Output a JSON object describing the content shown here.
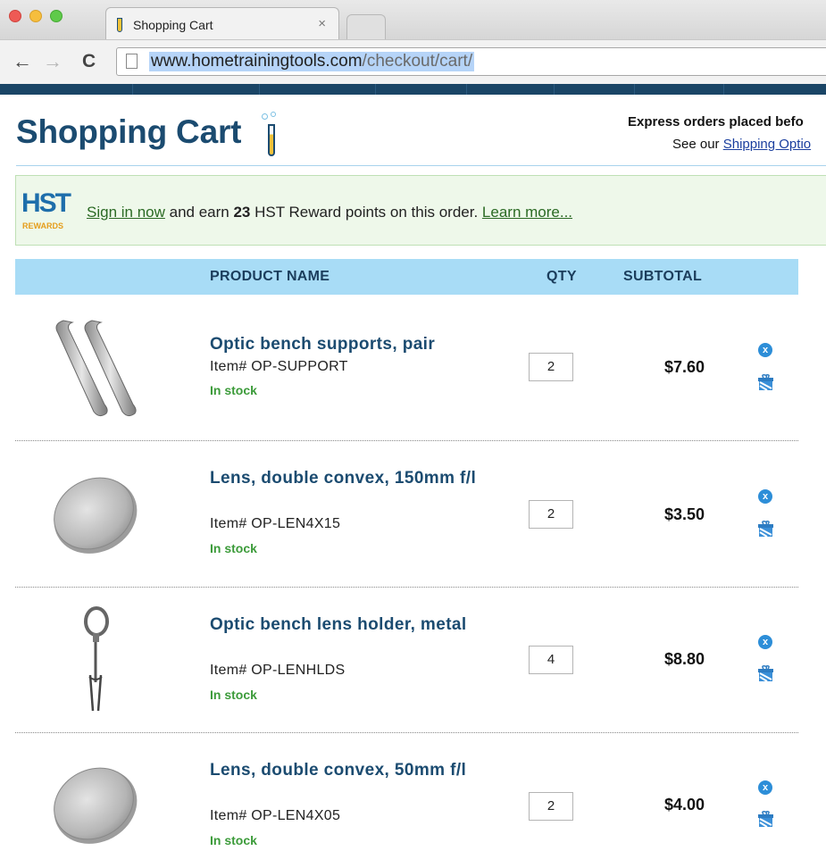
{
  "browser": {
    "tab_title": "Shopping Cart",
    "tab_close": "×",
    "nav_back": "←",
    "nav_forward": "→",
    "nav_reload": "C",
    "url_domain": "www.hometrainingtools.com",
    "url_path": "/checkout/cart/"
  },
  "page": {
    "title": "Shopping Cart",
    "express_text": "Express orders placed befo",
    "shipping_prefix": "See our ",
    "shipping_link": "Shipping Optio"
  },
  "rewards": {
    "logo_text": "HST",
    "logo_sub": "REWARDS",
    "signin_link": "Sign in now",
    "text_before_points": " and earn ",
    "points": "23",
    "text_after_points": " HST Reward points on this order. ",
    "learn_more_link": "Learn more..."
  },
  "cart_header": {
    "product_name": "PRODUCT NAME",
    "qty": "QTY",
    "subtotal": "SUBTOTAL"
  },
  "items": [
    {
      "name": "Optic bench supports, pair",
      "item": "Item# OP-SUPPORT",
      "stock": "In stock",
      "qty": "2",
      "subtotal": "$7.60",
      "thumb": "bench-supports-icon"
    },
    {
      "name": "Lens, double convex, 150mm f/l",
      "item": "Item# OP-LEN4X15",
      "stock": "In stock",
      "qty": "2",
      "subtotal": "$3.50",
      "thumb": "lens-icon"
    },
    {
      "name": "Optic bench lens holder, metal",
      "item": "Item# OP-LENHLDS",
      "stock": "In stock",
      "qty": "4",
      "subtotal": "$8.80",
      "thumb": "lens-holder-icon"
    },
    {
      "name": "Lens, double convex, 50mm f/l",
      "item": "Item# OP-LEN4X05",
      "stock": "In stock",
      "qty": "2",
      "subtotal": "$4.00",
      "thumb": "lens-icon"
    }
  ],
  "colors": {
    "brand_navy": "#1b4b70",
    "header_blue": "#a8dcf6",
    "stock_green": "#3c9b3a",
    "remove_blue": "#2d8ed8",
    "rewards_bg": "#eef8ea"
  }
}
